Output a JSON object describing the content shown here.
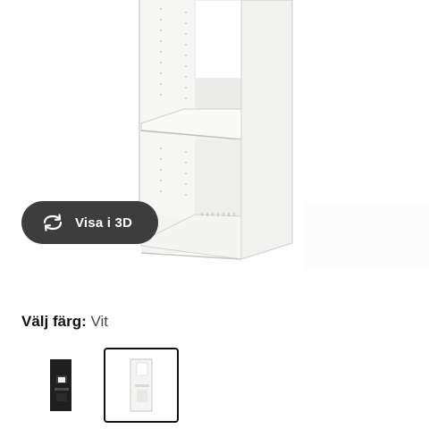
{
  "view_3d": {
    "label": "Visa i 3D",
    "icon": "rotate-3d-icon"
  },
  "color_selector": {
    "heading_label": "Välj färg:",
    "selected_value": "Vit",
    "options": [
      {
        "name": "black",
        "color": "#1f1f1f",
        "selected": false
      },
      {
        "name": "white",
        "color": "#f4f4f2",
        "selected": true
      }
    ]
  }
}
